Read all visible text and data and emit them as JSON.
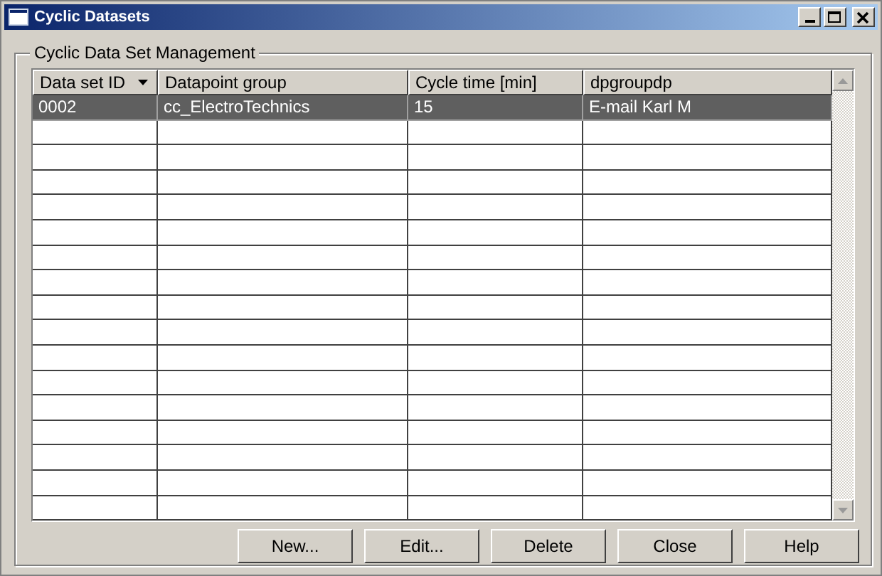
{
  "window": {
    "title": "Cyclic Datasets"
  },
  "group": {
    "title": "Cyclic Data Set Management"
  },
  "table": {
    "columns": [
      {
        "label": "Data set ID",
        "sorted": true
      },
      {
        "label": "Datapoint group",
        "sorted": false
      },
      {
        "label": "Cycle time [min]",
        "sorted": false
      },
      {
        "label": "dpgroupdp",
        "sorted": false
      }
    ],
    "rows": [
      {
        "cells": [
          "0002",
          "cc_ElectroTechnics",
          "15",
          "E-mail Karl M"
        ],
        "selected": true
      }
    ]
  },
  "buttons": [
    "New...",
    "Edit...",
    "Delete",
    "Close",
    "Help"
  ]
}
